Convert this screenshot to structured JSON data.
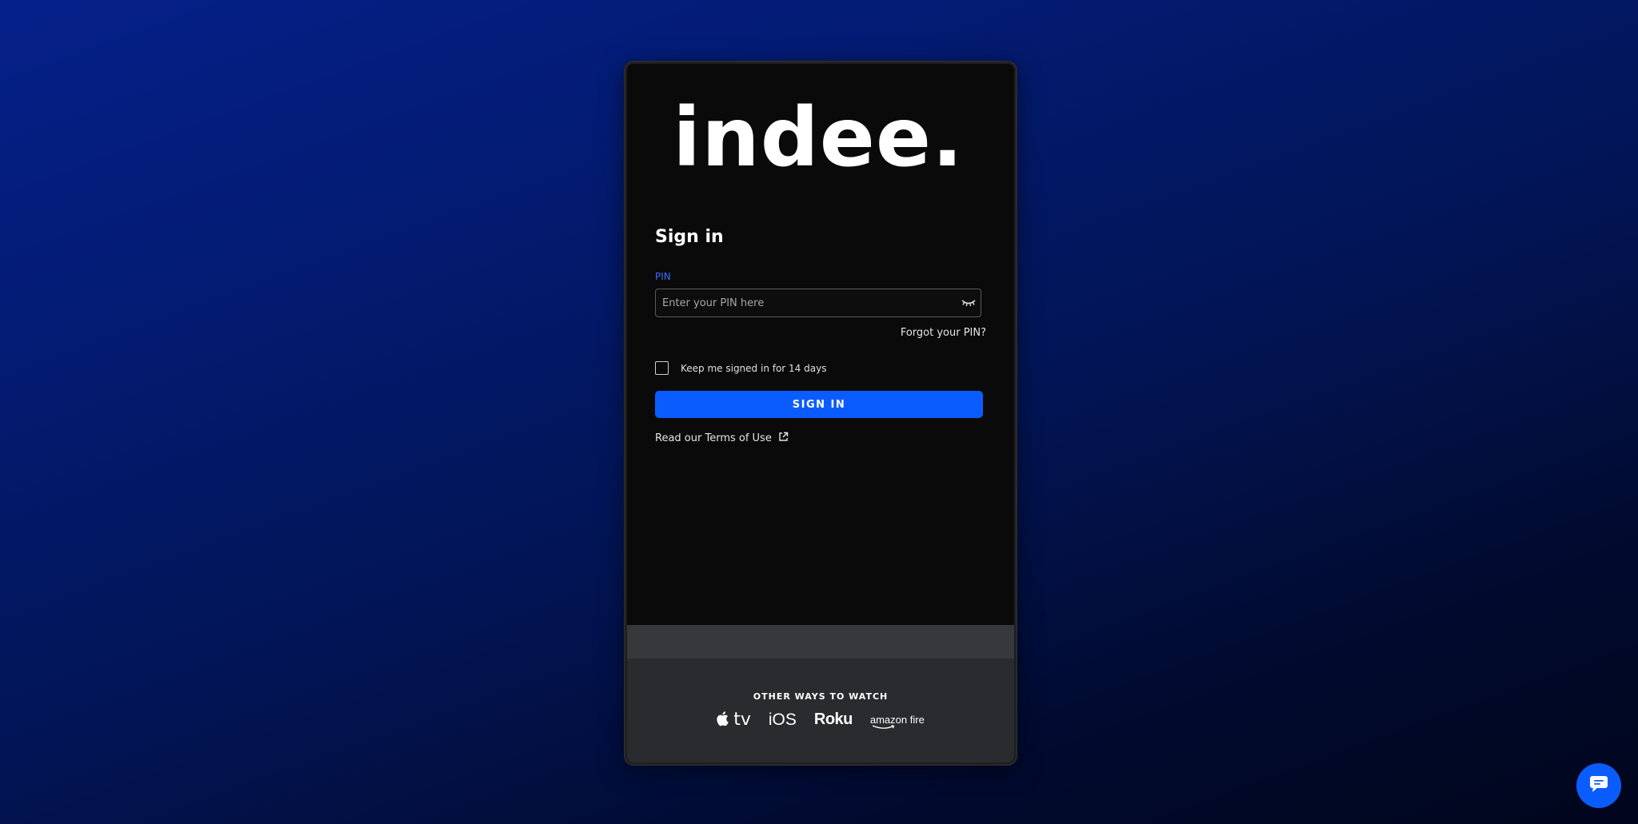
{
  "brand": {
    "logo_text": "indee."
  },
  "signin": {
    "title": "Sign in",
    "pin_label": "PIN",
    "pin_placeholder": "Enter your PIN here",
    "pin_value": "",
    "forgot_label": "Forgot your PIN?",
    "keep_signed_label": "Keep me signed in for 14 days",
    "keep_signed_checked": false,
    "submit_label": "SIGN IN",
    "terms_label": "Read our Terms of Use"
  },
  "footer": {
    "heading": "OTHER WAYS TO WATCH",
    "platforms": [
      {
        "name": "apple-tv",
        "label": "tv"
      },
      {
        "name": "ios",
        "label": "iOS"
      },
      {
        "name": "roku",
        "label": "Roku"
      },
      {
        "name": "amazon-fire",
        "label": "amazon fire"
      }
    ]
  },
  "icons": {
    "password_toggle": "eye-closed-icon",
    "terms_link": "external-link-icon",
    "chat": "chat-icon",
    "apple": "apple-icon"
  },
  "colors": {
    "accent": "#0b5cff",
    "pin_label": "#3b6dff",
    "card_bg": "#0a0a0a",
    "footer_bg": "#2a2b2e"
  }
}
